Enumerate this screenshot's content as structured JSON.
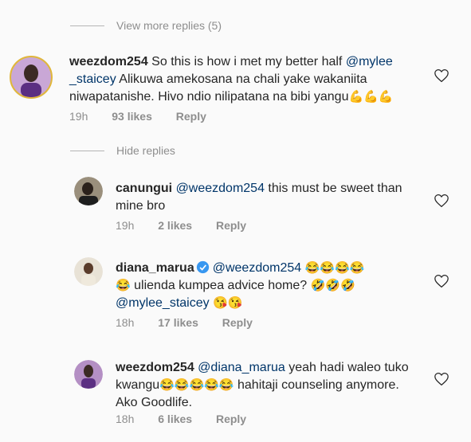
{
  "view_more_replies": "View more replies (5)",
  "hide_replies": "Hide replies",
  "comments": [
    {
      "username": "weezdom254",
      "text_parts": [
        "So this is how i met my better half ",
        "@mylee",
        "_staicey",
        " Alikuwa amekosana na chali yake wakaniita",
        "niwapatanishe. Hivo ndio nilipatana na bibi yangu"
      ],
      "time": "19h",
      "likes": "93 likes",
      "reply": "Reply"
    },
    {
      "username": "canungui",
      "mention": "@weezdom254",
      "text_line1": " this must be sweet than",
      "text_line2": "mine bro",
      "time": "19h",
      "likes": "2 likes",
      "reply": "Reply"
    },
    {
      "username": "diana_marua",
      "mention": "@weezdom254",
      "text_line2": " ulienda kumpea advice home?",
      "mention2": "@mylee_staicey",
      "time": "18h",
      "likes": "17 likes",
      "reply": "Reply"
    },
    {
      "username": "weezdom254",
      "mention": "@diana_marua",
      "text_line1": " yeah hadi waleo tuko",
      "text_line2a": "kwangu",
      "text_line2b": " hahitaji counseling anymore.",
      "text_line3": "Ako Goodlife.",
      "time": "18h",
      "likes": "6 likes",
      "reply": "Reply"
    }
  ],
  "icons": {
    "heart": "heart-outline-icon",
    "verified": "verified-badge-icon",
    "emoji_flex": "flexed-biceps-emoji",
    "emoji_laugh": "tears-of-joy-emoji",
    "emoji_rofl": "rolling-on-floor-laughing-emoji",
    "emoji_kiss": "kissing-heart-emoji"
  },
  "colors": {
    "mention": "#003569",
    "muted": "#8e8e8e",
    "verified": "#3897f0"
  }
}
